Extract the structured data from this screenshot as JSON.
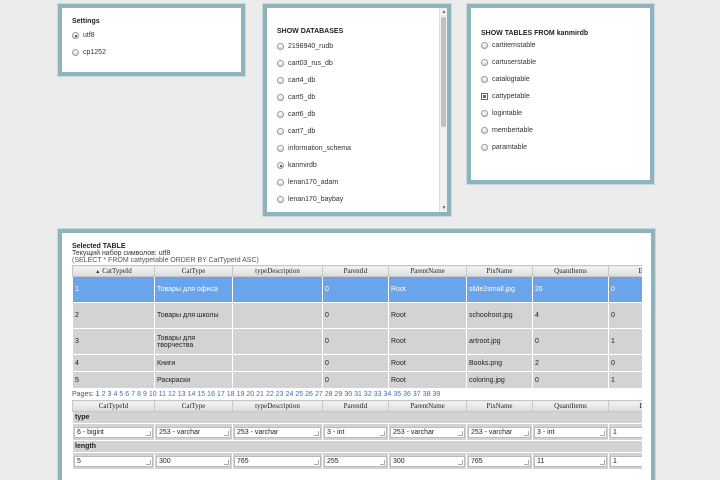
{
  "settings": {
    "title": "Settings",
    "options": [
      {
        "label": "utf8",
        "checked": true
      },
      {
        "label": "cp1252",
        "checked": false
      }
    ]
  },
  "databases": {
    "title": "SHOW DATABASES",
    "items": [
      {
        "label": "2198940_rudb",
        "checked": false
      },
      {
        "label": "cart03_rus_db",
        "checked": false
      },
      {
        "label": "cart4_db",
        "checked": false
      },
      {
        "label": "cart5_db",
        "checked": false
      },
      {
        "label": "cart6_db",
        "checked": false
      },
      {
        "label": "cart7_db",
        "checked": false
      },
      {
        "label": "information_schema",
        "checked": false
      },
      {
        "label": "kanmirdb",
        "checked": true
      },
      {
        "label": "lenan170_adam",
        "checked": false
      },
      {
        "label": "lenan170_baybay",
        "checked": false
      }
    ]
  },
  "tables": {
    "title": "SHOW TABLES FROM kanmirdb",
    "items": [
      {
        "label": "cartitemstable",
        "checked": false
      },
      {
        "label": "cartuserstable",
        "checked": false
      },
      {
        "label": "catalogtable",
        "checked": false
      },
      {
        "label": "cattypetable",
        "checked": true
      },
      {
        "label": "logintable",
        "checked": false
      },
      {
        "label": "membertable",
        "checked": false
      },
      {
        "label": "paramtable",
        "checked": false
      }
    ]
  },
  "selected": {
    "title": "Selected TABLE",
    "charset_line": "Текущий набор символов: utf8",
    "query": "(SELECT * FROM cattypetable ORDER BY CatTypeId ASC)",
    "sort_indicator": "▲",
    "columns": [
      "CatTypeId",
      "CatType",
      "typeDescription",
      "ParentId",
      "ParentName",
      "PixName",
      "QuantItems",
      "EndSubt"
    ],
    "rows": [
      [
        "1",
        "Товары для офиса",
        "",
        "0",
        "Root",
        "slide2small.jpg",
        "26",
        "0"
      ],
      [
        "2",
        "Товары для школы",
        "",
        "0",
        "Root",
        "schoolroot.jpg",
        "4",
        "0"
      ],
      [
        "3",
        "Товары для творчества",
        "",
        "0",
        "Root",
        "artroot.jpg",
        "0",
        "1"
      ],
      [
        "4",
        "Книги",
        "",
        "0",
        "Root",
        "Books.png",
        "2",
        "0"
      ],
      [
        "5",
        "Раскраски",
        "",
        "0",
        "Root",
        "coloring.jpg",
        "0",
        "1"
      ]
    ],
    "pages_label": "Pages:",
    "pages": [
      "1",
      "2",
      "3",
      "4",
      "5",
      "6",
      "7",
      "8",
      "9",
      "10",
      "11",
      "12",
      "13",
      "14",
      "15",
      "16",
      "17",
      "18",
      "19",
      "20",
      "21",
      "22",
      "23",
      "24",
      "25",
      "26",
      "27",
      "28",
      "29",
      "30",
      "31",
      "32",
      "33",
      "34",
      "35",
      "36",
      "37",
      "38",
      "39"
    ],
    "meta_columns": [
      "CatTypeId",
      "CatType",
      "typeDescription",
      "ParentId",
      "ParentName",
      "PixName",
      "QuantItems",
      "EndSub"
    ],
    "type_label": "type",
    "types": [
      "6 - bigint",
      "253 - varchar",
      "253 - varchar",
      "3 - int",
      "253 - varchar",
      "253 - varchar",
      "3 - int",
      "1"
    ],
    "length_label": "length",
    "lengths": [
      "5",
      "300",
      "765",
      "255",
      "300",
      "765",
      "11",
      "1"
    ]
  }
}
